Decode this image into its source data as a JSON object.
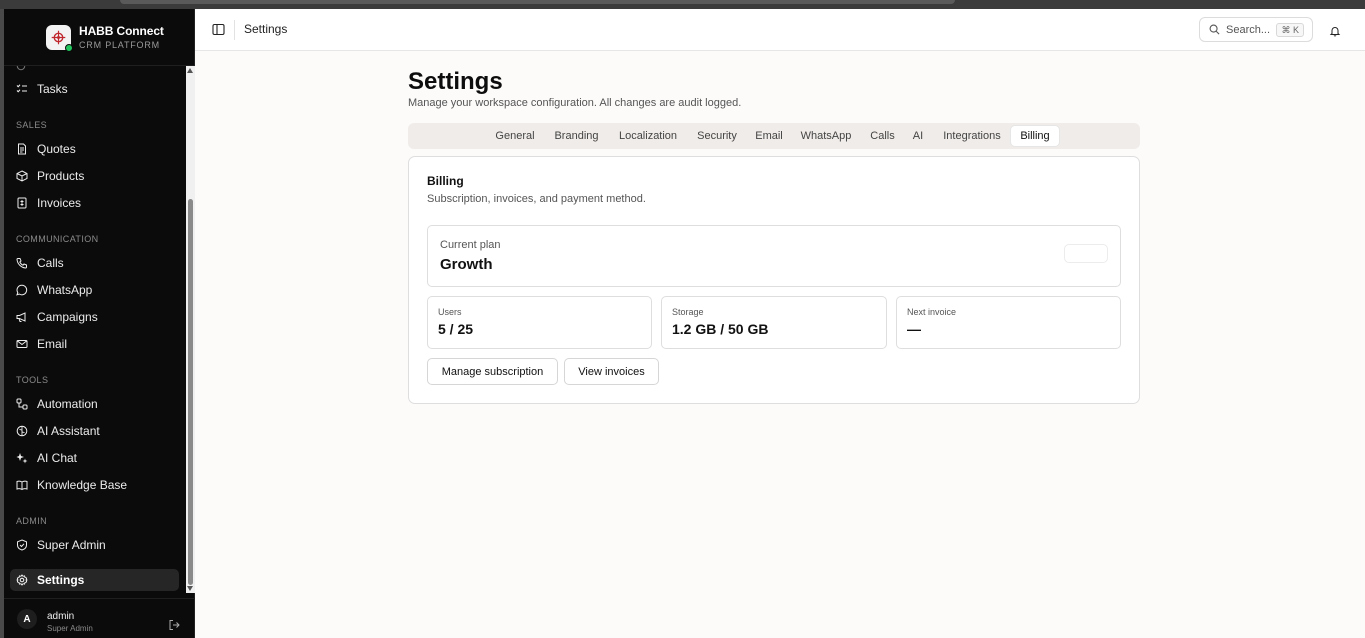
{
  "brand": {
    "name": "HABB Connect",
    "subtitle": "CRM PLATFORM"
  },
  "sidebar": {
    "sections": [
      {
        "label": "SALES"
      },
      {
        "label": "COMMUNICATION"
      },
      {
        "label": "TOOLS"
      },
      {
        "label": "ADMIN"
      }
    ],
    "items": [
      {
        "label": "Tasks",
        "icon": "tasks-icon"
      },
      {
        "label": "Quotes",
        "icon": "document-icon"
      },
      {
        "label": "Products",
        "icon": "box-icon"
      },
      {
        "label": "Invoices",
        "icon": "invoice-icon"
      },
      {
        "label": "Calls",
        "icon": "phone-icon"
      },
      {
        "label": "WhatsApp",
        "icon": "chat-bubble-icon"
      },
      {
        "label": "Campaigns",
        "icon": "megaphone-icon"
      },
      {
        "label": "Email",
        "icon": "mail-icon"
      },
      {
        "label": "Automation",
        "icon": "workflow-icon"
      },
      {
        "label": "AI Assistant",
        "icon": "brain-icon"
      },
      {
        "label": "AI Chat",
        "icon": "sparkles-icon"
      },
      {
        "label": "Knowledge Base",
        "icon": "book-icon"
      },
      {
        "label": "Super Admin",
        "icon": "shield-icon"
      },
      {
        "label": "Settings",
        "icon": "gear-icon",
        "active": true
      }
    ]
  },
  "user": {
    "initial": "A",
    "name": "admin",
    "role": "Super Admin"
  },
  "topbar": {
    "breadcrumb": "Settings",
    "search_placeholder": "Search...",
    "shortcut": "⌘ K"
  },
  "page": {
    "title": "Settings",
    "subtitle": "Manage your workspace configuration. All changes are audit logged."
  },
  "tabs": [
    {
      "label": "General"
    },
    {
      "label": "Branding"
    },
    {
      "label": "Localization"
    },
    {
      "label": "Security"
    },
    {
      "label": "Email"
    },
    {
      "label": "WhatsApp"
    },
    {
      "label": "Calls"
    },
    {
      "label": "AI"
    },
    {
      "label": "Integrations"
    },
    {
      "label": "Billing",
      "active": true
    }
  ],
  "billing": {
    "title": "Billing",
    "subtitle": "Subscription, invoices, and payment method.",
    "plan_label": "Current plan",
    "plan_value": "Growth",
    "stats": [
      {
        "label": "Users",
        "value": "5 / 25"
      },
      {
        "label": "Storage",
        "value": "1.2 GB / 50 GB"
      },
      {
        "label": "Next invoice",
        "value": "—"
      }
    ],
    "manage_label": "Manage subscription",
    "invoices_label": "View invoices"
  },
  "colors": {
    "sidebar_bg": "#0b0b0b",
    "main_bg": "#fcfbfa",
    "status_online": "#22c55e"
  }
}
